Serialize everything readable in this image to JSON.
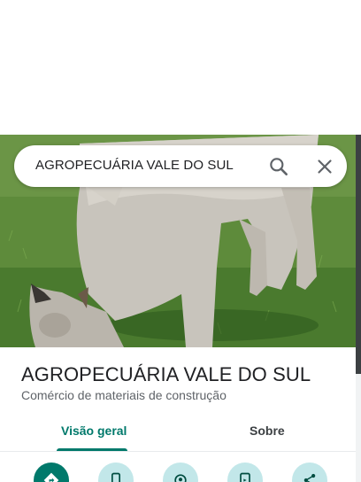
{
  "search": {
    "value": "AGROPECUÁRIA VALE DO SUL"
  },
  "place": {
    "name": "AGROPECUÁRIA VALE DO SUL",
    "category": "Comércio de materiais de construção"
  },
  "tabs": [
    {
      "label": "Visão geral",
      "selected": true
    },
    {
      "label": "Sobre",
      "selected": false
    }
  ],
  "actions": [
    {
      "icon": "directions-icon"
    },
    {
      "icon": "phone-icon"
    },
    {
      "icon": "nearby-icon"
    },
    {
      "icon": "send-to-phone-icon"
    },
    {
      "icon": "share-icon"
    }
  ],
  "colors": {
    "accent": "#00796b",
    "action_bg": "#c2e7e9"
  }
}
